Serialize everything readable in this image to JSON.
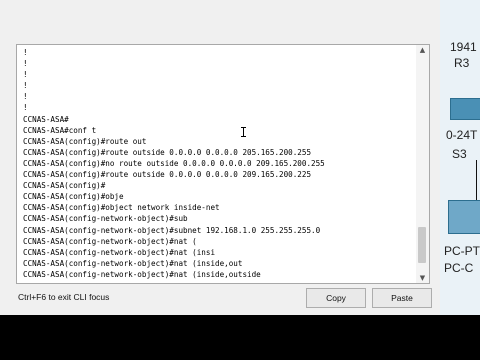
{
  "terminal": {
    "lines": [
      "!",
      "!",
      "!",
      "!",
      "!",
      "!",
      "CCNAS-ASA#",
      "CCNAS-ASA#conf t",
      "CCNAS-ASA(config)#route out",
      "CCNAS-ASA(config)#route outside 0.0.0.0 0.0.0.0 205.165.200.255",
      "CCNAS-ASA(config)#no route outside 0.0.0.0 0.0.0.0 209.165.200.255",
      "CCNAS-ASA(config)#route outside 0.0.0.0 0.0.0.0 209.165.200.225",
      "CCNAS-ASA(config)#",
      "CCNAS-ASA(config)#obje",
      "CCNAS-ASA(config)#object network inside-net",
      "CCNAS-ASA(config-network-object)#sub",
      "CCNAS-ASA(config-network-object)#subnet 192.168.1.0 255.255.255.0",
      "CCNAS-ASA(config-network-object)#nat (",
      "CCNAS-ASA(config-network-object)#nat (insi",
      "CCNAS-ASA(config-network-object)#nat (inside,out",
      "CCNAS-ASA(config-network-object)#nat (inside,outside"
    ],
    "scroll_position": 0.85
  },
  "bottom_bar": {
    "hint": "Ctrl+F6 to exit CLI focus",
    "copy_label": "Copy",
    "paste_label": "Paste"
  },
  "right_pane": {
    "labels": [
      "1941",
      "R3",
      "0-24T",
      "S3",
      "PC-PT",
      "PC-C"
    ]
  }
}
